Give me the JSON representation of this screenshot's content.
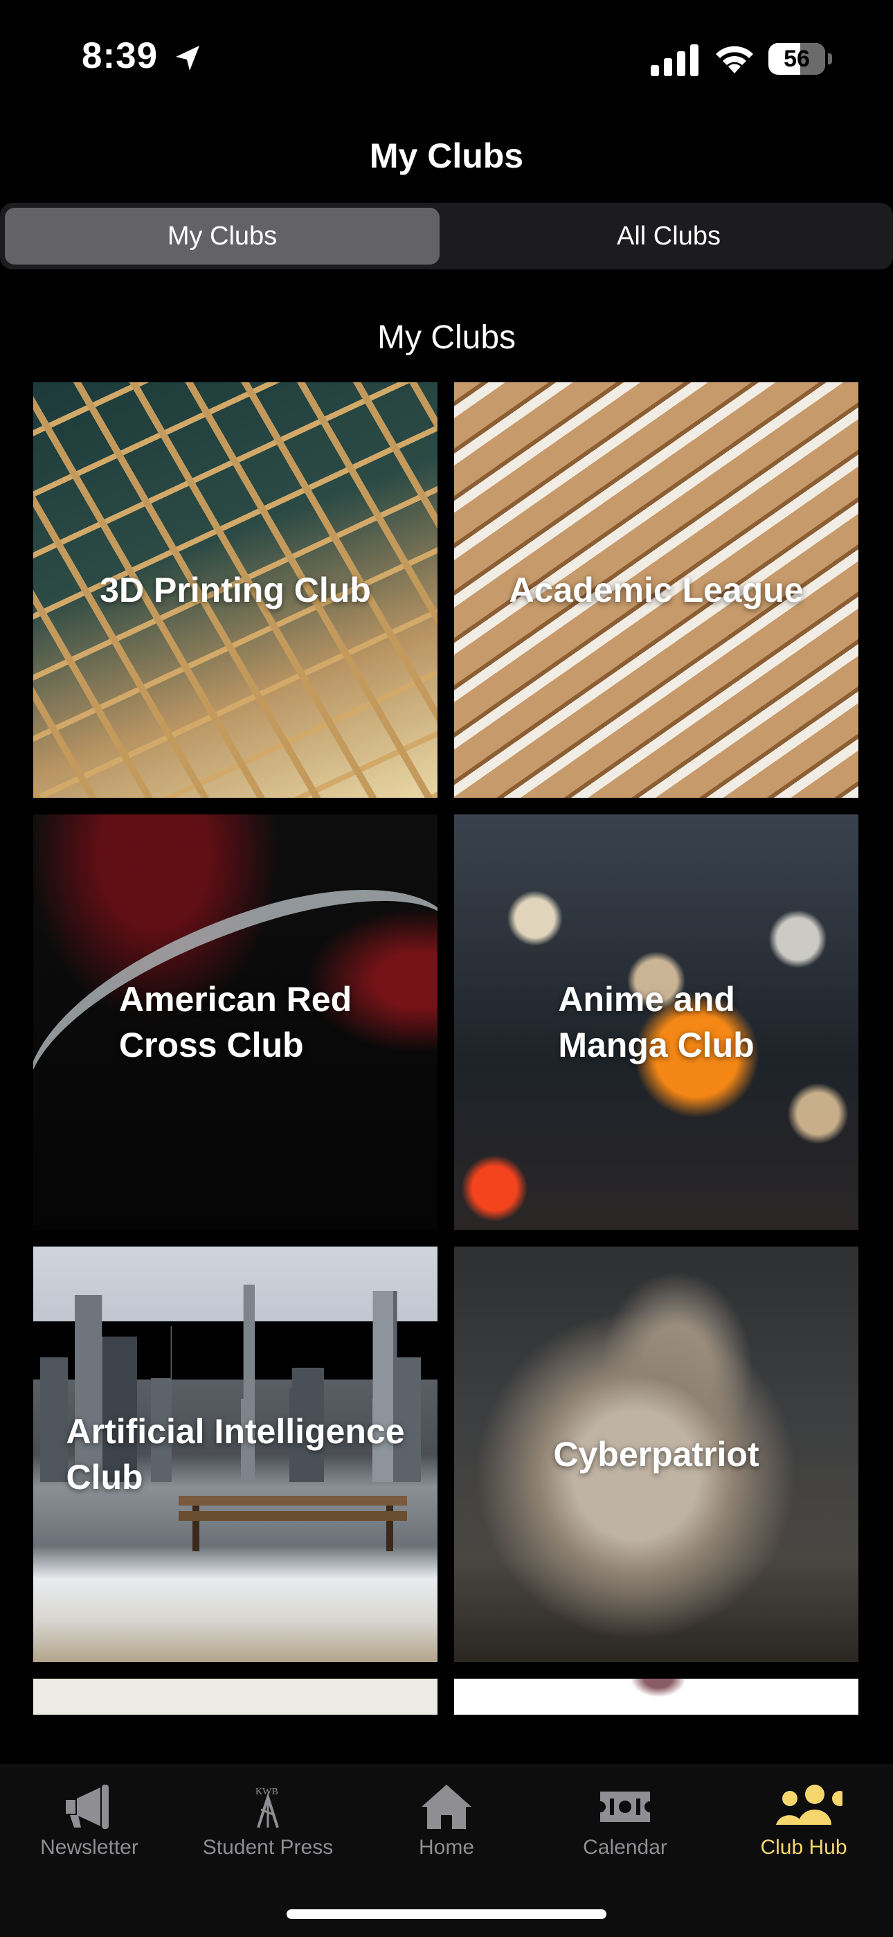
{
  "status_bar": {
    "time": "8:39",
    "battery": "56"
  },
  "nav": {
    "title": "My Clubs"
  },
  "segmented_control": {
    "options": [
      "My Clubs",
      "All Clubs"
    ],
    "selected": "My Clubs"
  },
  "section": {
    "header": "My Clubs"
  },
  "clubs": [
    {
      "name_lines": [
        "3D Printing Club"
      ]
    },
    {
      "name_lines": [
        "Academic League"
      ]
    },
    {
      "name_lines": [
        "American Red",
        "Cross Club"
      ]
    },
    {
      "name_lines": [
        "Anime and",
        "Manga Club"
      ]
    },
    {
      "name_lines": [
        "Artificial Intelligence",
        "Club"
      ]
    },
    {
      "name_lines": [
        "Cyberpatriot"
      ]
    }
  ],
  "tab_bar": {
    "items": [
      {
        "label": "Newsletter",
        "icon": "megaphone-icon"
      },
      {
        "label": "Student Press",
        "icon": "student-press-logo-icon"
      },
      {
        "label": "Home",
        "icon": "home-icon"
      },
      {
        "label": "Calendar",
        "icon": "ticket-icon"
      },
      {
        "label": "Club Hub",
        "icon": "people-icon"
      }
    ],
    "active": "Club Hub",
    "active_color": "#f5d76e",
    "inactive_color": "#8e8e93"
  }
}
